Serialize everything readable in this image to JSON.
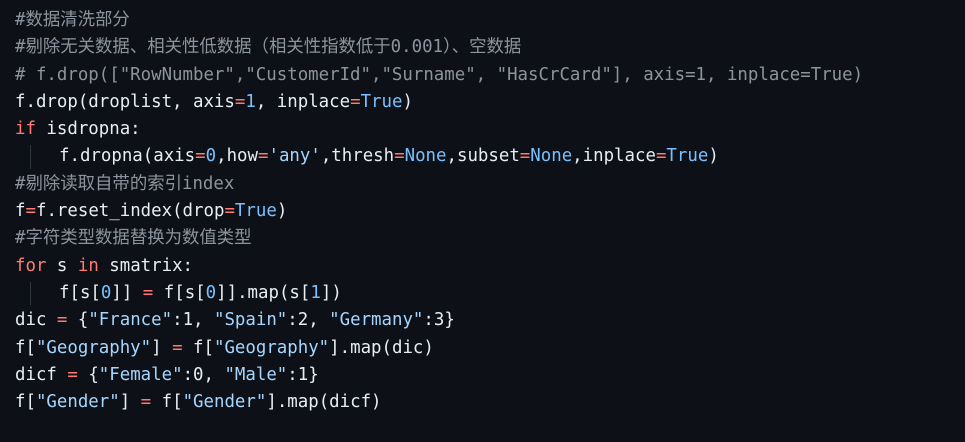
{
  "code": {
    "language": "python",
    "colors": {
      "background": "#0d1117",
      "text": "#e6edf3",
      "comment": "#8b949e",
      "keyword": "#ff7b72",
      "number": "#79c0ff",
      "string": "#a5d6ff"
    },
    "lines": [
      {
        "indent": false,
        "tokens": [
          {
            "t": "comment",
            "v": "#数据清洗部分"
          }
        ]
      },
      {
        "indent": false,
        "tokens": [
          {
            "t": "comment",
            "v": "#剔除无关数据、相关性低数据（相关性指数低于0.001）、空数据"
          }
        ]
      },
      {
        "indent": false,
        "tokens": [
          {
            "t": "comment",
            "v": "# f.drop([\"RowNumber\",\"CustomerId\",\"Surname\", \"HasCrCard\"], axis=1, inplace=True)"
          }
        ]
      },
      {
        "indent": false,
        "tokens": [
          {
            "t": "plain",
            "v": "f.drop(droplist, axis"
          },
          {
            "t": "op",
            "v": "="
          },
          {
            "t": "num",
            "v": "1"
          },
          {
            "t": "plain",
            "v": ", inplace"
          },
          {
            "t": "op",
            "v": "="
          },
          {
            "t": "const",
            "v": "True"
          },
          {
            "t": "plain",
            "v": ")"
          }
        ]
      },
      {
        "indent": false,
        "tokens": [
          {
            "t": "kw",
            "v": "if"
          },
          {
            "t": "plain",
            "v": " isdropna:"
          }
        ]
      },
      {
        "indent": true,
        "tokens": [
          {
            "t": "plain",
            "v": "f.dropna(axis"
          },
          {
            "t": "op",
            "v": "="
          },
          {
            "t": "num",
            "v": "0"
          },
          {
            "t": "plain",
            "v": ",how"
          },
          {
            "t": "op",
            "v": "="
          },
          {
            "t": "str",
            "v": "'any'"
          },
          {
            "t": "plain",
            "v": ",thresh"
          },
          {
            "t": "op",
            "v": "="
          },
          {
            "t": "const",
            "v": "None"
          },
          {
            "t": "plain",
            "v": ",subset"
          },
          {
            "t": "op",
            "v": "="
          },
          {
            "t": "const",
            "v": "None"
          },
          {
            "t": "plain",
            "v": ",inplace"
          },
          {
            "t": "op",
            "v": "="
          },
          {
            "t": "const",
            "v": "True"
          },
          {
            "t": "plain",
            "v": ")"
          }
        ]
      },
      {
        "indent": false,
        "tokens": [
          {
            "t": "comment",
            "v": "#剔除读取自带的索引index"
          }
        ]
      },
      {
        "indent": false,
        "tokens": [
          {
            "t": "plain",
            "v": "f"
          },
          {
            "t": "op",
            "v": "="
          },
          {
            "t": "plain",
            "v": "f.reset_index(drop"
          },
          {
            "t": "op",
            "v": "="
          },
          {
            "t": "const",
            "v": "True"
          },
          {
            "t": "plain",
            "v": ")"
          }
        ]
      },
      {
        "indent": false,
        "tokens": [
          {
            "t": "comment",
            "v": "#字符类型数据替换为数值类型"
          }
        ]
      },
      {
        "indent": false,
        "tokens": [
          {
            "t": "kw",
            "v": "for"
          },
          {
            "t": "plain",
            "v": " s "
          },
          {
            "t": "kw",
            "v": "in"
          },
          {
            "t": "plain",
            "v": " smatrix:"
          }
        ]
      },
      {
        "indent": true,
        "tokens": [
          {
            "t": "plain",
            "v": "f[s["
          },
          {
            "t": "num",
            "v": "0"
          },
          {
            "t": "plain",
            "v": "]] "
          },
          {
            "t": "op",
            "v": "="
          },
          {
            "t": "plain",
            "v": " f[s["
          },
          {
            "t": "num",
            "v": "0"
          },
          {
            "t": "plain",
            "v": "]].map(s["
          },
          {
            "t": "num",
            "v": "1"
          },
          {
            "t": "plain",
            "v": "])"
          }
        ]
      },
      {
        "indent": false,
        "tokens": [
          {
            "t": "plain",
            "v": "dic "
          },
          {
            "t": "op",
            "v": "="
          },
          {
            "t": "plain",
            "v": " {"
          },
          {
            "t": "str",
            "v": "\"France\""
          },
          {
            "t": "plain",
            "v": ":1, "
          },
          {
            "t": "str",
            "v": "\"Spain\""
          },
          {
            "t": "plain",
            "v": ":2, "
          },
          {
            "t": "str",
            "v": "\"Germany\""
          },
          {
            "t": "plain",
            "v": ":3}"
          }
        ]
      },
      {
        "indent": false,
        "tokens": [
          {
            "t": "plain",
            "v": "f["
          },
          {
            "t": "str",
            "v": "\"Geography\""
          },
          {
            "t": "plain",
            "v": "] "
          },
          {
            "t": "op",
            "v": "="
          },
          {
            "t": "plain",
            "v": " f["
          },
          {
            "t": "str",
            "v": "\"Geography\""
          },
          {
            "t": "plain",
            "v": "].map(dic)"
          }
        ]
      },
      {
        "indent": false,
        "tokens": [
          {
            "t": "plain",
            "v": "dicf "
          },
          {
            "t": "op",
            "v": "="
          },
          {
            "t": "plain",
            "v": " {"
          },
          {
            "t": "str",
            "v": "\"Female\""
          },
          {
            "t": "plain",
            "v": ":0, "
          },
          {
            "t": "str",
            "v": "\"Male\""
          },
          {
            "t": "plain",
            "v": ":1}"
          }
        ]
      },
      {
        "indent": false,
        "tokens": [
          {
            "t": "plain",
            "v": "f["
          },
          {
            "t": "str",
            "v": "\"Gender\""
          },
          {
            "t": "plain",
            "v": "] "
          },
          {
            "t": "op",
            "v": "="
          },
          {
            "t": "plain",
            "v": " f["
          },
          {
            "t": "str",
            "v": "\"Gender\""
          },
          {
            "t": "plain",
            "v": "].map(dicf)"
          }
        ]
      }
    ]
  }
}
